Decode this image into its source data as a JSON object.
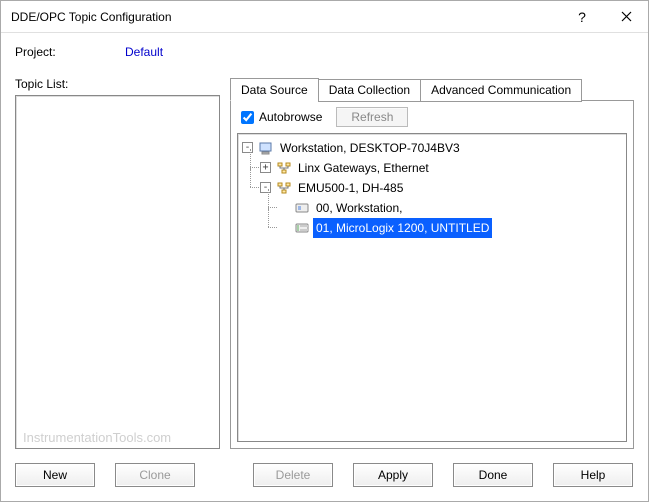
{
  "window": {
    "title": "DDE/OPC Topic Configuration"
  },
  "project": {
    "label": "Project:",
    "value": "Default"
  },
  "topic_list": {
    "label": "Topic List:"
  },
  "tabs": [
    {
      "label": "Data Source",
      "active": true
    },
    {
      "label": "Data Collection",
      "active": false
    },
    {
      "label": "Advanced Communication",
      "active": false
    }
  ],
  "panel": {
    "autobrowse_label": "Autobrowse",
    "autobrowse_checked": true,
    "refresh_label": "Refresh"
  },
  "tree": {
    "root": {
      "icon": "workstation-icon",
      "label": "Workstation, DESKTOP-70J4BV3",
      "expanded": true,
      "children": [
        {
          "icon": "network-icon",
          "label": "Linx Gateways, Ethernet",
          "expanded": false
        },
        {
          "icon": "network-icon",
          "label": "EMU500-1, DH-485",
          "expanded": true,
          "children": [
            {
              "icon": "device-icon",
              "label": "00, Workstation,",
              "leaf": true
            },
            {
              "icon": "plc-icon",
              "label": "01, MicroLogix 1200, UNTITLED",
              "leaf": true,
              "selected": true
            }
          ]
        }
      ]
    }
  },
  "buttons": {
    "new": "New",
    "clone": "Clone",
    "delete": "Delete",
    "apply": "Apply",
    "done": "Done",
    "help": "Help"
  },
  "watermark": "InstrumentationTools.com"
}
